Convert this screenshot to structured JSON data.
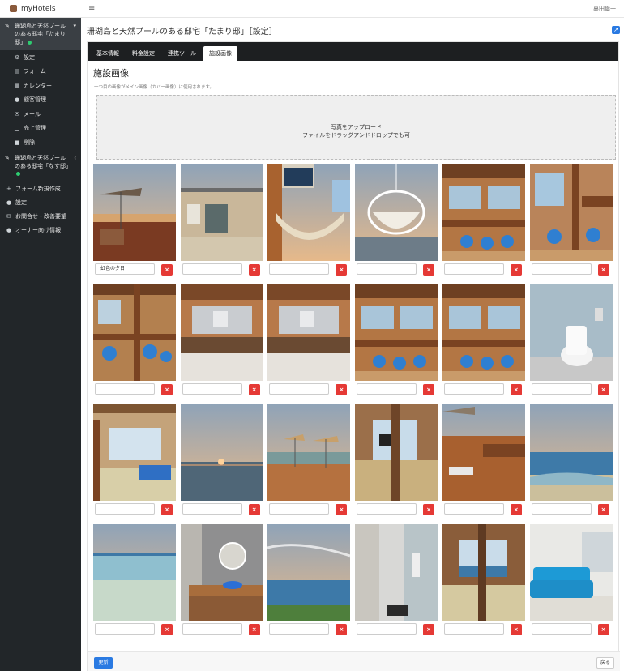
{
  "app": {
    "name": "myHotels"
  },
  "topbar": {
    "menu_icon": "menu-icon",
    "user": "裏田倫一"
  },
  "header": {
    "title": "珊瑚島と天然プールのある邸宅「たまり邸」［設定］",
    "ext_icon": "external-link-icon"
  },
  "sidebar": {
    "hotel1": {
      "name": "珊瑚島と天然プールのある邸宅「たまり邸」",
      "chevron": "chevron-down-icon"
    },
    "subs": [
      {
        "label": "設定",
        "icon": "gear-icon",
        "glyph": "⚙"
      },
      {
        "label": "フォーム",
        "icon": "form-icon",
        "glyph": "▤"
      },
      {
        "label": "カレンダー",
        "icon": "calendar-icon",
        "glyph": "▦"
      },
      {
        "label": "顧客管理",
        "icon": "user-icon",
        "glyph": "●"
      },
      {
        "label": "メール",
        "icon": "mail-icon",
        "glyph": "✉"
      },
      {
        "label": "売上管理",
        "icon": "chart-icon",
        "glyph": "▁"
      },
      {
        "label": "削除",
        "icon": "trash-icon",
        "glyph": "■"
      }
    ],
    "hotel2": {
      "name": "珊瑚島と天然プールのある邸宅「なす邸」",
      "chevron": "chevron-left-icon"
    },
    "navs": [
      {
        "label": "フォーム新規作成",
        "icon": "plus-icon",
        "glyph": "+"
      },
      {
        "label": "設定",
        "icon": "users-icon",
        "glyph": "●"
      },
      {
        "label": "お問合せ・改善要望",
        "icon": "mail-icon",
        "glyph": "✉"
      },
      {
        "label": "オーナー向け情報",
        "icon": "info-icon",
        "glyph": "●"
      }
    ]
  },
  "tabs": [
    "基本情報",
    "料金設定",
    "連携ツール",
    "施設画像"
  ],
  "active_tab": 3,
  "section": {
    "title": "施設画像",
    "note": "一つ目の画像がメイン画像（カバー画像）に使用されます。"
  },
  "upload": {
    "line1": "写真をアップロード",
    "line2": "ファイルをドラッグアンドドロップでも可"
  },
  "photos": [
    {
      "caption": "虹色の夕日",
      "scene": "sunset-umbrella"
    },
    {
      "caption": "",
      "scene": "house-exterior"
    },
    {
      "caption": "",
      "scene": "hammock"
    },
    {
      "caption": "",
      "scene": "hanging-chair"
    },
    {
      "caption": "",
      "scene": "wood-dining"
    },
    {
      "caption": "",
      "scene": "wood-dining-window"
    },
    {
      "caption": "",
      "scene": "dining-chairs"
    },
    {
      "caption": "",
      "scene": "kitchen"
    },
    {
      "caption": "",
      "scene": "kitchen"
    },
    {
      "caption": "",
      "scene": "wood-dining"
    },
    {
      "caption": "",
      "scene": "wood-dining"
    },
    {
      "caption": "",
      "scene": "bathroom"
    },
    {
      "caption": "",
      "scene": "tatami-room"
    },
    {
      "caption": "",
      "scene": "ocean-sunset"
    },
    {
      "caption": "",
      "scene": "deck-umbrellas"
    },
    {
      "caption": "",
      "scene": "room-window"
    },
    {
      "caption": "",
      "scene": "deck-bench"
    },
    {
      "caption": "",
      "scene": "beach-blue"
    },
    {
      "caption": "",
      "scene": "shallow-sea"
    },
    {
      "caption": "",
      "scene": "vanity-mirror"
    },
    {
      "caption": "",
      "scene": "ocean-sky"
    },
    {
      "caption": "",
      "scene": "shower-room"
    },
    {
      "caption": "",
      "scene": "tatami-window"
    },
    {
      "caption": "",
      "scene": "blue-sofa"
    }
  ],
  "delete_label": "×",
  "footer": {
    "update": "更新",
    "back": "戻る"
  }
}
